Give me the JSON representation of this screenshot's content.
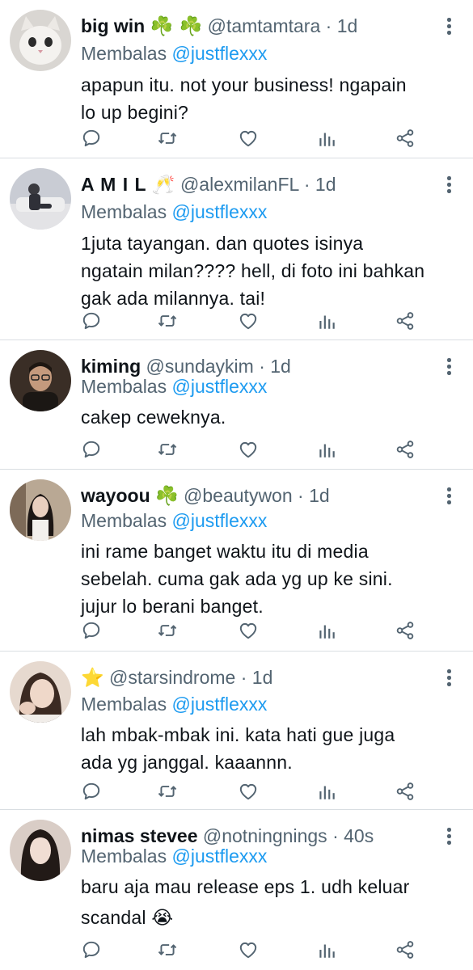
{
  "tweets": [
    {
      "name": "big win",
      "name_emoji": "☘️ ☘️",
      "handle": "@tamtamtara",
      "time": "1d",
      "replying_label": "Membalas",
      "replying_to": "@justflexxx",
      "text": "apapun itu. not your business! ngapain\nlo up begini?",
      "avatar_desc": "white cat photo"
    },
    {
      "name": "A M I L",
      "name_emoji": "🥂",
      "handle": "@alexmilanFL",
      "time": "1d",
      "replying_label": "Membalas",
      "replying_to": "@justflexxx",
      "text": "1juta tayangan. dan quotes isinya\nngatain milan???? hell, di foto ini bahkan\ngak ada milannya. tai!",
      "avatar_desc": "person sitting on sofa"
    },
    {
      "name": "kiming",
      "name_emoji": "",
      "handle": "@sundaykim",
      "time": "1d",
      "replying_label": "Membalas",
      "replying_to": "@justflexxx",
      "text": "cakep ceweknya.",
      "avatar_desc": "man with glasses"
    },
    {
      "name": "wayoou",
      "name_emoji": "☘️",
      "handle": "@beautywon",
      "time": "1d",
      "replying_label": "Membalas",
      "replying_to": "@justflexxx",
      "text": "ini rame banget waktu itu di media\nsebelah. cuma gak ada yg up ke sini.\njujur lo berani banget.",
      "avatar_desc": "woman with long hair"
    },
    {
      "name": "",
      "name_emoji": "⭐",
      "handle": "@starsindrome",
      "time": "1d",
      "replying_label": "Membalas",
      "replying_to": "@justflexxx",
      "text": "lah mbak-mbak ini. kata hati gue juga\nada yg janggal. kaaannn.",
      "avatar_desc": "woman resting head"
    },
    {
      "name": "nimas stevee",
      "name_emoji": "",
      "handle": "@notningnings",
      "time": "40s",
      "replying_label": "Membalas",
      "replying_to": "@justflexxx",
      "text": "baru aja mau release eps 1. udh keluar\nscandal 😭",
      "avatar_desc": "woman with dark hair"
    }
  ],
  "separator": "·",
  "icons": {
    "reply": "reply-icon",
    "retweet": "retweet-icon",
    "like": "like-icon",
    "views": "views-icon",
    "share": "share-icon",
    "more": "more-icon"
  },
  "colors": {
    "text": "#0f1419",
    "muted": "#536471",
    "mention": "#1d9bf0",
    "divider": "#d9dee2"
  }
}
